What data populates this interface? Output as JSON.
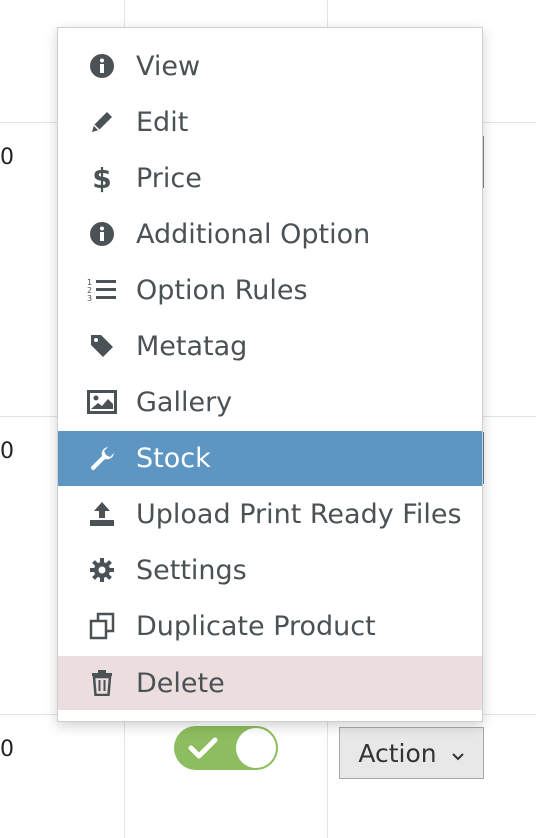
{
  "table": {
    "row_values": [
      "0",
      "0",
      "0"
    ]
  },
  "row3": {
    "toggle_checked": true,
    "action_label": "Action",
    "action_caret": "⌄"
  },
  "menu": {
    "items": [
      {
        "label": "View",
        "icon": "info-icon"
      },
      {
        "label": "Edit",
        "icon": "pencil-icon"
      },
      {
        "label": "Price",
        "icon": "dollar-icon"
      },
      {
        "label": "Additional Option",
        "icon": "info-icon"
      },
      {
        "label": "Option Rules",
        "icon": "numbered-list-icon"
      },
      {
        "label": "Metatag",
        "icon": "tag-icon"
      },
      {
        "label": "Gallery",
        "icon": "image-icon"
      },
      {
        "label": "Stock",
        "icon": "wrench-icon",
        "state": "active"
      },
      {
        "label": "Upload Print Ready Files",
        "icon": "upload-icon"
      },
      {
        "label": "Settings",
        "icon": "gear-icon"
      },
      {
        "label": "Duplicate Product",
        "icon": "copy-icon"
      },
      {
        "label": "Delete",
        "icon": "trash-icon",
        "state": "danger"
      }
    ]
  },
  "colors": {
    "active_bg": "#5e96c3",
    "danger_bg": "#ecdede",
    "toggle_on": "#8cbd5e",
    "menu_text": "#4b5256"
  }
}
